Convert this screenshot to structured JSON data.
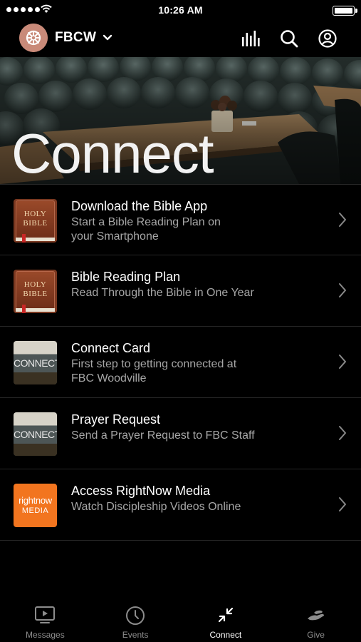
{
  "status_bar": {
    "time": "10:26 AM"
  },
  "header": {
    "brand_name": "FBCW"
  },
  "hero": {
    "title": "Connect"
  },
  "items": [
    {
      "title": "Download the Bible App",
      "subtitle_line1": "Start a Bible Reading Plan on",
      "subtitle_line2": "your Smartphone",
      "thumb_text_1": "HOLY",
      "thumb_text_2": "BIBLE"
    },
    {
      "title": "Bible Reading Plan",
      "subtitle_line1": "Read Through the Bible in One Year",
      "subtitle_line2": "",
      "thumb_text_1": "HOLY",
      "thumb_text_2": "BIBLE"
    },
    {
      "title": "Connect Card",
      "subtitle_line1": "First step to getting connected at",
      "subtitle_line2": "FBC Woodville",
      "thumb_text_1": "CONNECT"
    },
    {
      "title": "Prayer Request",
      "subtitle_line1": "Send a Prayer Request to FBC Staff",
      "subtitle_line2": "",
      "thumb_text_1": "CONNECT"
    },
    {
      "title": "Access RightNow Media",
      "subtitle_line1": "Watch Discipleship Videos Online",
      "subtitle_line2": "",
      "thumb_text_1": "rightnow",
      "thumb_text_2": "MEDIA"
    }
  ],
  "tabs": [
    {
      "label": "Messages",
      "icon": "tv-play-icon",
      "active": false
    },
    {
      "label": "Events",
      "icon": "clock-icon",
      "active": false
    },
    {
      "label": "Connect",
      "icon": "collapse-arrows-icon",
      "active": true
    },
    {
      "label": "Give",
      "icon": "giving-hand-icon",
      "active": false
    }
  ],
  "colors": {
    "background": "#000000",
    "accent_orange": "#f2751f",
    "brand_logo": "#c98a79",
    "muted_text": "#a6a6a6"
  }
}
